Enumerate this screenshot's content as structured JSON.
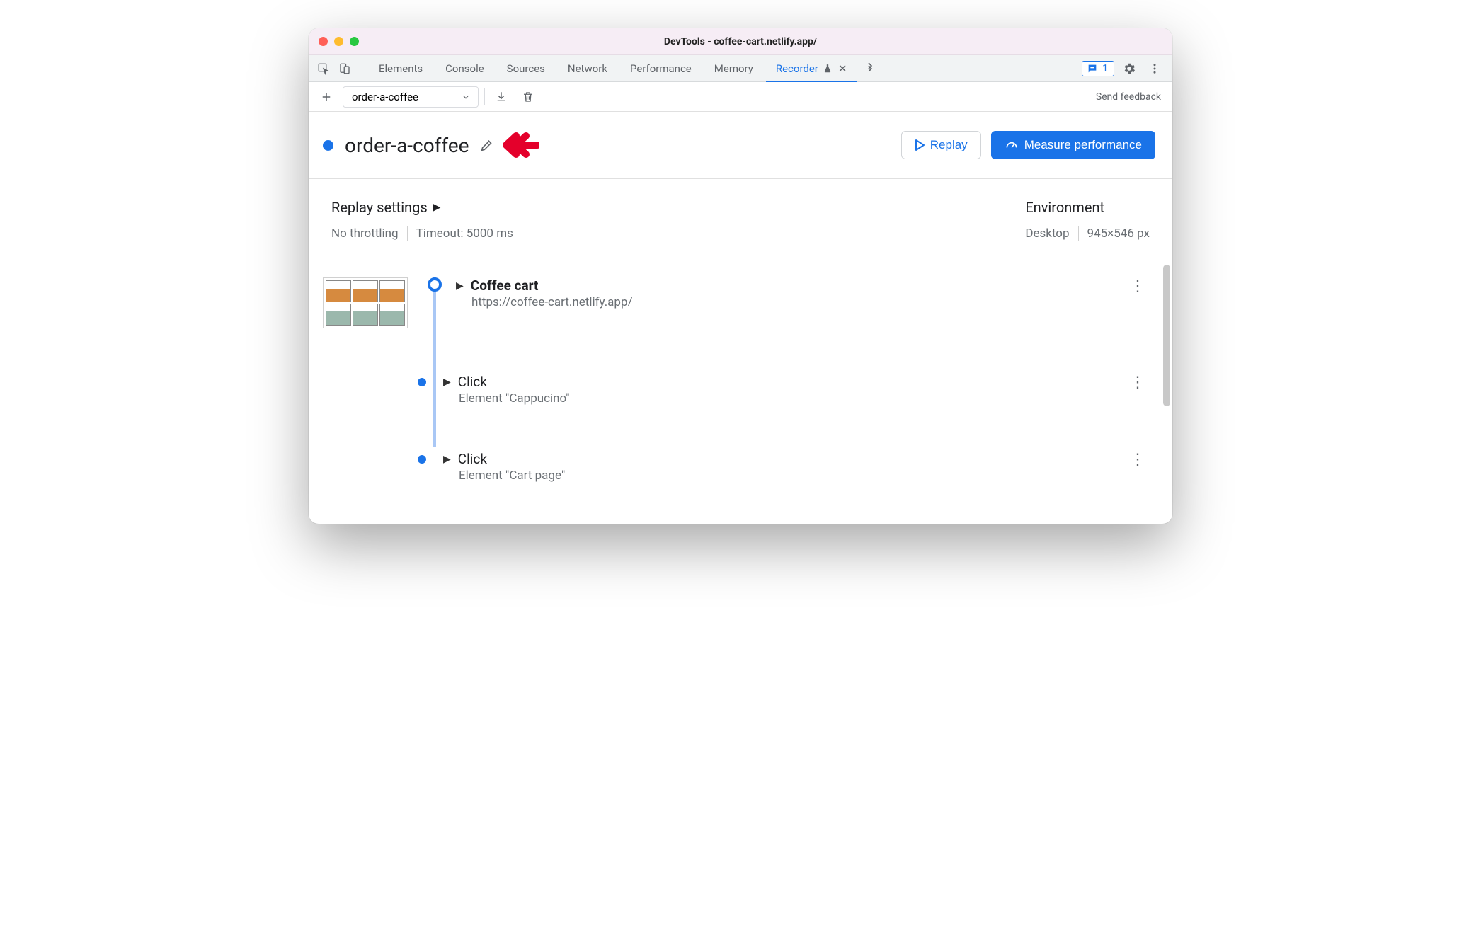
{
  "window": {
    "title": "DevTools - coffee-cart.netlify.app/"
  },
  "tabs": {
    "elements": "Elements",
    "console": "Console",
    "sources": "Sources",
    "network": "Network",
    "performance": "Performance",
    "memory": "Memory",
    "recorder": "Recorder"
  },
  "issues": {
    "count": "1"
  },
  "subtoolbar": {
    "selected_recording": "order-a-coffee",
    "send_feedback": "Send feedback"
  },
  "recording": {
    "title": "order-a-coffee",
    "replay_label": "Replay",
    "measure_label": "Measure performance"
  },
  "replay_settings": {
    "title": "Replay settings",
    "throttling": "No throttling",
    "timeout": "Timeout: 5000 ms"
  },
  "environment": {
    "title": "Environment",
    "device": "Desktop",
    "viewport": "945×546 px"
  },
  "steps": [
    {
      "title": "Coffee cart",
      "sub": "https://coffee-cart.netlify.app/",
      "bold": true
    },
    {
      "title": "Click",
      "sub": "Element \"Cappucino\"",
      "bold": false
    },
    {
      "title": "Click",
      "sub": "Element \"Cart page\"",
      "bold": false
    }
  ]
}
